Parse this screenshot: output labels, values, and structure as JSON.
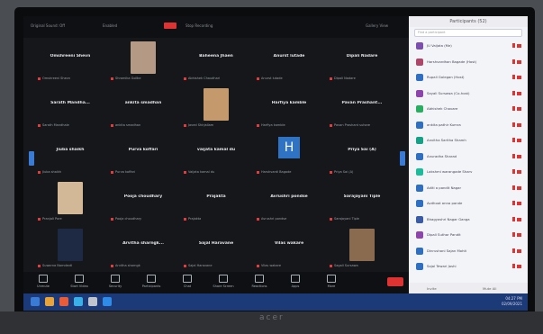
{
  "topbar": {
    "items": [
      "Original Sound: Off",
      "Enabled",
      "Stop Recording",
      "Spotlight Video",
      "Gallery View"
    ]
  },
  "participants": [
    {
      "name": "Omshreeni Shevn",
      "label": "Omshreeni Shevn"
    },
    {
      "name": "",
      "label": "Shramika Gollke",
      "photo": "a"
    },
    {
      "name": "Baheena Jhaen",
      "label": "Abhishek Chaudhari"
    },
    {
      "name": "Anurst lutade",
      "label": "Anurst lutade"
    },
    {
      "name": "Dipali Nadare",
      "label": "Dipali Nadare"
    },
    {
      "name": "Sarath Mandha...",
      "label": "Sarath Mandhale"
    },
    {
      "name": "ankita smadhan",
      "label": "ankita smadhan"
    },
    {
      "name": "",
      "label": "Javed Shirjailam",
      "photo": "b"
    },
    {
      "name": "Harfiya kamble",
      "label": "Harfiya kamble"
    },
    {
      "name": "Pavan Prashant...",
      "label": "Pavan Prashant suhare"
    },
    {
      "name": "Jiuba shaikh",
      "label": "Jiuba shaikh"
    },
    {
      "name": "Purva koffari",
      "label": "Purva koffari"
    },
    {
      "name": "vaijata kamal du",
      "label": "Vaijata kamal du"
    },
    {
      "name": "",
      "label": "Harshvardi Bagade",
      "initial": "H"
    },
    {
      "name": "Priya Sai (A)",
      "label": "Priya Sai (A)"
    },
    {
      "name": "",
      "label": "Pranjali Pore",
      "photo": "c"
    },
    {
      "name": "Pooja choudhary",
      "label": "Pooja choudhary"
    },
    {
      "name": "Prajakta",
      "label": "Prajakta"
    },
    {
      "name": "Avrushri pondse",
      "label": "Avrushri pondse"
    },
    {
      "name": "Sarajayani Tiple",
      "label": "Sarajayani Tiple"
    },
    {
      "name": "",
      "label": "Suwarna Namdevtl",
      "photo": "d"
    },
    {
      "name": "Arvitha sharngk...",
      "label": "Arvitha sharngk"
    },
    {
      "name": "Sajal Haravane",
      "label": "Sajal Haravane"
    },
    {
      "name": "Vilas wakare",
      "label": "Vilas wakare"
    },
    {
      "name": "",
      "label": "Sagali Sursawa",
      "photo": "e"
    }
  ],
  "toolbar": [
    {
      "label": "Unmute",
      "icon": "mic-icon"
    },
    {
      "label": "Start Video",
      "icon": "video-icon"
    },
    {
      "label": "Security",
      "icon": "shield-icon"
    },
    {
      "label": "Participants",
      "icon": "people-icon"
    },
    {
      "label": "Chat",
      "icon": "chat-icon"
    },
    {
      "label": "Share Screen",
      "icon": "share-icon"
    },
    {
      "label": "Reactions",
      "icon": "reaction-icon"
    },
    {
      "label": "Apps",
      "icon": "apps-icon"
    },
    {
      "label": "More",
      "icon": "more-icon"
    }
  ],
  "panel": {
    "title": "Participants (52)",
    "search_placeholder": "Find a participant",
    "rows": [
      {
        "name": "JU Vaijata (Me)",
        "color": "#7a4fb0"
      },
      {
        "name": "Harshvardhan Bagade (Host)",
        "color": "#b0456a"
      },
      {
        "name": "Rupali Golegan (Host)",
        "color": "#2f6fc2"
      },
      {
        "name": "Sayali Sursawa (Co-host)",
        "color": "#8e44ad"
      },
      {
        "name": "Abhishek Chavare",
        "color": "#27ae60"
      },
      {
        "name": "ankita pathir Kumra",
        "color": "#2f6fc2"
      },
      {
        "name": "Anvitha Saritha Shamh",
        "color": "#16a085"
      },
      {
        "name": "Anuradha Sharad",
        "color": "#2f6fc2"
      },
      {
        "name": "Lakshmi warangade Sharv",
        "color": "#1abc9c"
      },
      {
        "name": "Aditi a pandit Nagar",
        "color": "#2f6fc2"
      },
      {
        "name": "Avdhoot anna pande",
        "color": "#2f6fc2"
      },
      {
        "name": "Bhagyashri Nagar Ganga",
        "color": "#3b5ba5"
      },
      {
        "name": "Dipali Suthar Pandit",
        "color": "#8e44ad"
      },
      {
        "name": "Dinrushani Sajan Mohit",
        "color": "#2f6fc2"
      },
      {
        "name": "Sajal Tewari Joshi",
        "color": "#2f6fc2"
      }
    ],
    "footer_left": "Invite",
    "footer_right": "Mute All"
  },
  "taskbar": {
    "time": "04:27 PM",
    "date": "02/09/2021"
  },
  "monitor_brand": "acer"
}
